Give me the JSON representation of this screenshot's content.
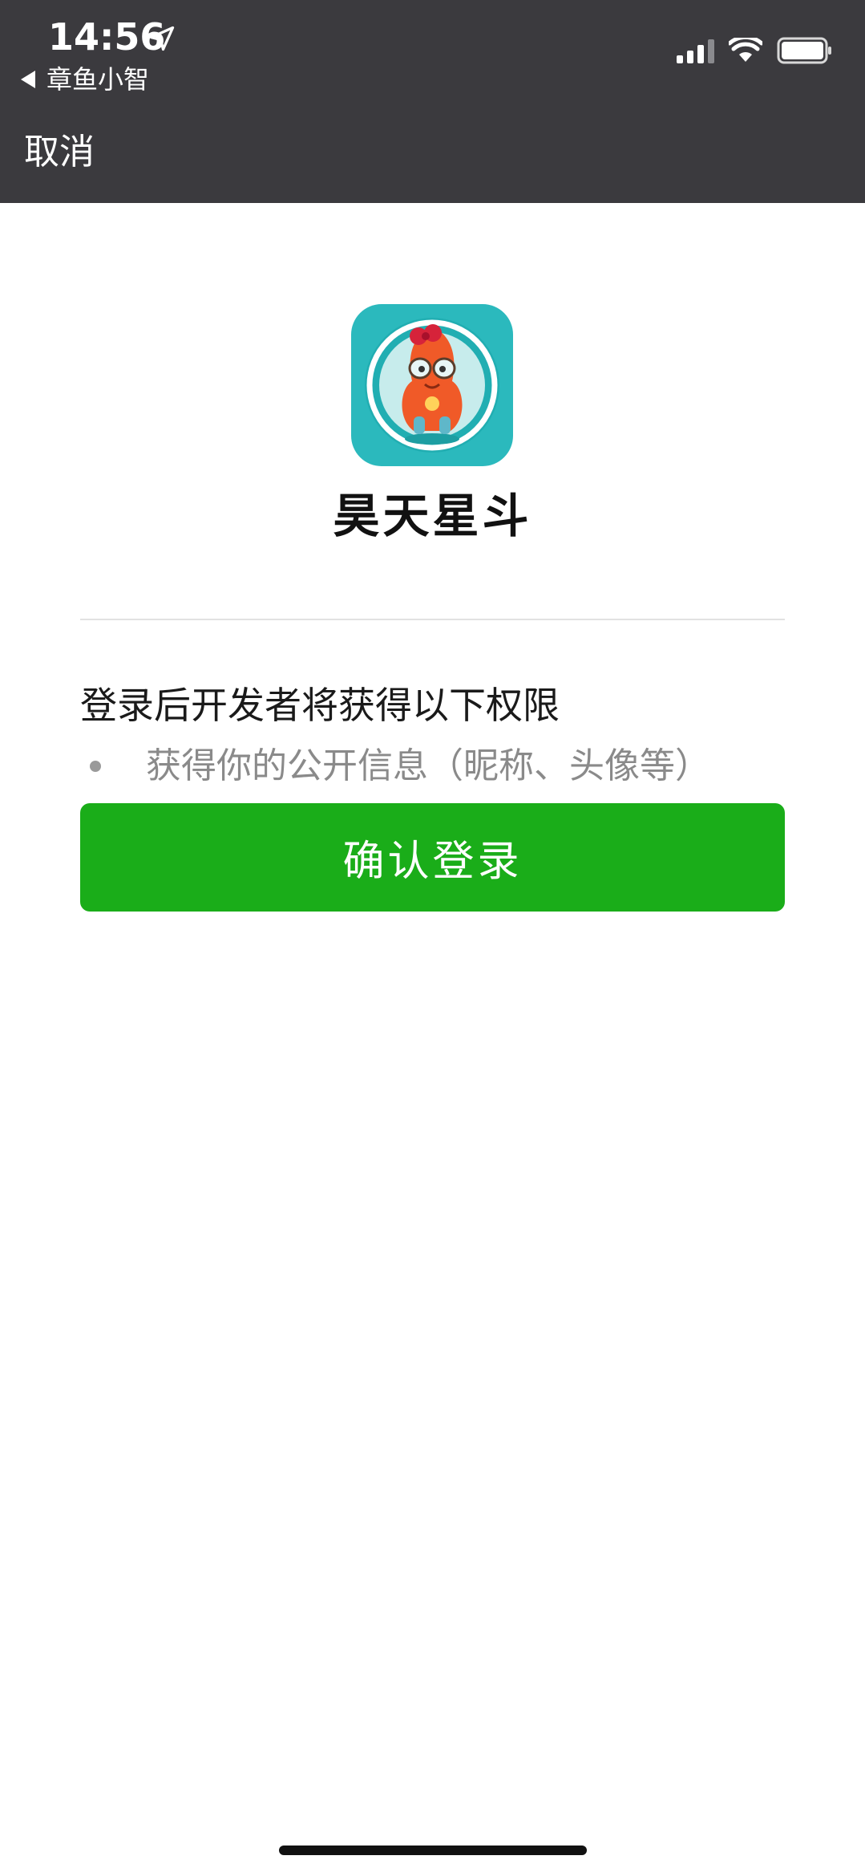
{
  "status_bar": {
    "time": "14:56",
    "back_app": "章鱼小智",
    "location_icon": "location-arrow-icon",
    "signal_icon": "cellular-signal-icon",
    "wifi_icon": "wifi-icon",
    "battery_icon": "battery-icon"
  },
  "nav": {
    "cancel_label": "取消"
  },
  "app": {
    "name": "昊天星斗",
    "icon": "octopus-mascot-icon",
    "icon_bg": "#2bb9bd"
  },
  "permissions": {
    "title": "登录后开发者将获得以下权限",
    "items": [
      {
        "label": "获得你的公开信息（昵称、头像等）"
      }
    ]
  },
  "actions": {
    "confirm_label": "确认登录",
    "confirm_color": "#1aad19"
  },
  "colors": {
    "header_bg": "#3b3a3e",
    "page_bg": "#ffffff"
  }
}
